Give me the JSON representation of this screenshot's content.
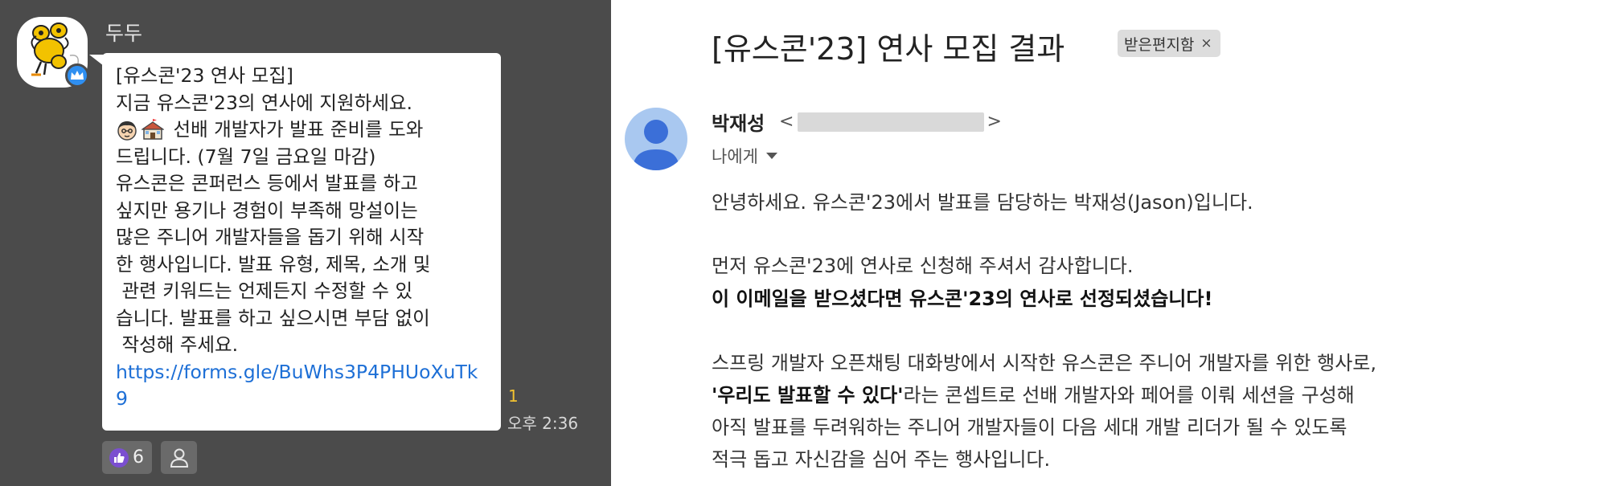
{
  "chat": {
    "sender_name": "두두",
    "message_lines": [
      "[유스콘'23 연사 모집]",
      "지금 유스콘'23의 연사에 지원하세요."
    ],
    "emoji_line_text": " 선배 개발자가 발표 준비를 도와",
    "message_lines_2": [
      "드립니다. (7월 7일 금요일 마감)",
      "유스콘은 콘퍼런스 등에서 발표를 하고",
      "싶지만 용기나 경험이 부족해 망설이는",
      "많은 주니어 개발자들을 돕기 위해 시작",
      "한 행사입니다. 발표 유형, 제목, 소개 및",
      " 관련 키워드는 언제든지 수정할 수 있",
      "습니다. 발표를 하고 싶으시면 부담 없이",
      " 작성해 주세요."
    ],
    "link_lines": [
      "https://forms.gle/BuWhs3P4PHUoXuTk",
      "9"
    ],
    "unread_count": "1",
    "time": "오후 2:36",
    "reaction_count": "6",
    "emoji_icons": [
      "man-face-emoji",
      "school-emoji"
    ]
  },
  "email": {
    "subject": "[유스콘'23] 연사 모집 결과",
    "label_chip": "받은편지함",
    "label_close": "×",
    "sender_name": "박재성",
    "address_open": "<",
    "address_close": ">",
    "recipient": "나에게",
    "body": {
      "greeting": "안녕하세요. 유스콘'23에서 발표를 담당하는 박재성(Jason)입니다.",
      "thanks": "먼저 유스콘'23에 연사로 신청해 주셔서 감사합니다.",
      "selected": "이 이메일을 받으셨다면 유스콘'23의 연사로 선정되셨습니다!",
      "p3_line1": "스프링 개발자 오픈채팅 대화방에서 시작한 유스콘은 주니어 개발자를 위한 행사로,",
      "p3_line2_bold": "'우리도 발표할 수 있다'",
      "p3_line2_rest": "라는 콘셉트로 선배 개발자와 페어를 이뤄 세션을 구성해",
      "p3_line3": "아직 발표를 두려워하는 주니어 개발자들이 다음 세대 개발 리더가 될 수 있도록",
      "p3_line4": "적극 돕고 자신감을 심어 주는 행사입니다."
    }
  },
  "colors": {
    "chat_bg": "#4b4b4b",
    "link": "#1d6fd6",
    "unread": "#f2c230",
    "reaction_purple": "#7b4fd0",
    "badge_blue": "#2f8ff0",
    "avatar_blue": "#a9c8f0"
  }
}
